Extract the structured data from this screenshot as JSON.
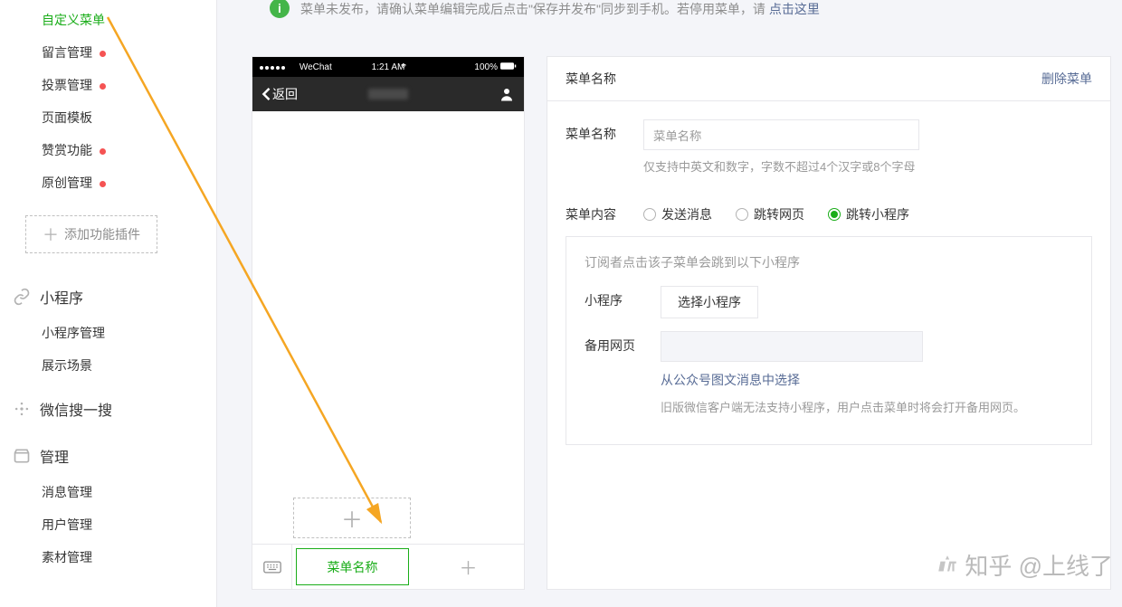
{
  "sidebar": {
    "items": [
      {
        "label": "自定义菜单",
        "active": true,
        "dot": false
      },
      {
        "label": "留言管理",
        "dot": true
      },
      {
        "label": "投票管理",
        "dot": true
      },
      {
        "label": "页面模板",
        "dot": false
      },
      {
        "label": "赞赏功能",
        "dot": true
      },
      {
        "label": "原创管理",
        "dot": true
      }
    ],
    "add_plugin": "添加功能插件",
    "sections": [
      {
        "title": "小程序",
        "icon": "link-icon",
        "items": [
          "小程序管理",
          "展示场景"
        ]
      },
      {
        "title": "微信搜一搜",
        "icon": "sparkle-icon",
        "items": []
      },
      {
        "title": "管理",
        "icon": "inbox-icon",
        "items": [
          "消息管理",
          "用户管理",
          "素材管理"
        ]
      }
    ]
  },
  "notice": {
    "text_prefix": "菜单未发布，请确认菜单编辑完成后点击\"保存并发布\"同步到手机。若停用菜单，请",
    "link": "点击这里"
  },
  "phone": {
    "carrier": "WeChat",
    "time": "1:21 AM",
    "battery": "100%",
    "back": "返回",
    "active_menu_label": "菜单名称"
  },
  "panel": {
    "head_title": "菜单名称",
    "delete": "删除菜单",
    "name_label": "菜单名称",
    "name_value": "菜单名称",
    "name_hint": "仅支持中英文和数字，字数不超过4个汉字或8个字母",
    "content_label": "菜单内容",
    "radios": {
      "send": "发送消息",
      "jump_web": "跳转网页",
      "jump_mp": "跳转小程序"
    },
    "inner": {
      "desc": "订阅者点击该子菜单会跳到以下小程序",
      "mp_label": "小程序",
      "mp_button": "选择小程序",
      "backup_label": "备用网页",
      "choose_link": "从公众号图文消息中选择",
      "old_note": "旧版微信客户端无法支持小程序，用户点击菜单时将会打开备用网页。"
    }
  },
  "watermark": "知乎 @上线了"
}
